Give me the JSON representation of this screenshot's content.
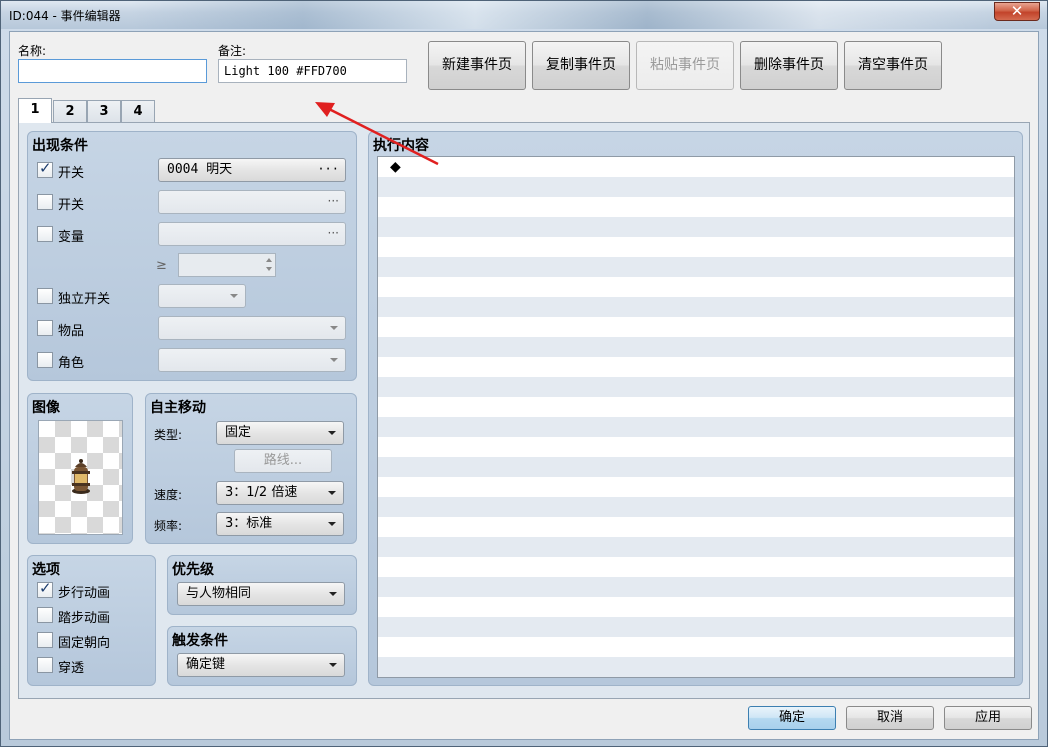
{
  "window": {
    "title": "ID:044 - 事件编辑器",
    "close_label": "✕"
  },
  "header": {
    "name_label": "名称:",
    "name_value": "",
    "note_label": "备注:",
    "note_value": "Light 100 #FFD700",
    "buttons": {
      "new": "新建事件页",
      "copy": "复制事件页",
      "paste": "粘贴事件页",
      "delete": "删除事件页",
      "clear": "清空事件页"
    }
  },
  "tabs": [
    "1",
    "2",
    "3",
    "4"
  ],
  "conditions": {
    "title": "出现条件",
    "switch1": {
      "label": "开关",
      "checked": true,
      "value": "0004 明天",
      "dots": "···"
    },
    "switch2": {
      "label": "开关",
      "checked": false,
      "value": "",
      "dots": "···"
    },
    "variable": {
      "label": "变量",
      "checked": false,
      "value": "",
      "dots": "···",
      "ge": "≥"
    },
    "self_switch": {
      "label": "独立开关",
      "checked": false
    },
    "item": {
      "label": "物品",
      "checked": false
    },
    "actor": {
      "label": "角色",
      "checked": false
    }
  },
  "image": {
    "title": "图像"
  },
  "autonomous": {
    "title": "自主移动",
    "type_label": "类型:",
    "type_value": "固定",
    "route_label": "路线...",
    "speed_label": "速度:",
    "speed_value": "3：1/2 倍速",
    "freq_label": "频率:",
    "freq_value": "3：标准"
  },
  "options": {
    "title": "选项",
    "walking": {
      "label": "步行动画",
      "checked": true
    },
    "stepping": {
      "label": "踏步动画",
      "checked": false
    },
    "direction_fix": {
      "label": "固定朝向",
      "checked": false
    },
    "through": {
      "label": "穿透",
      "checked": false
    }
  },
  "priority": {
    "title": "优先级",
    "value": "与人物相同"
  },
  "trigger": {
    "title": "触发条件",
    "value": "确定键"
  },
  "contents": {
    "title": "执行内容",
    "first_line": "◆"
  },
  "footer": {
    "ok": "确定",
    "cancel": "取消",
    "apply": "应用"
  },
  "colors": {
    "annotation_arrow": "#e02020",
    "panel_blue": "#bccde0"
  }
}
